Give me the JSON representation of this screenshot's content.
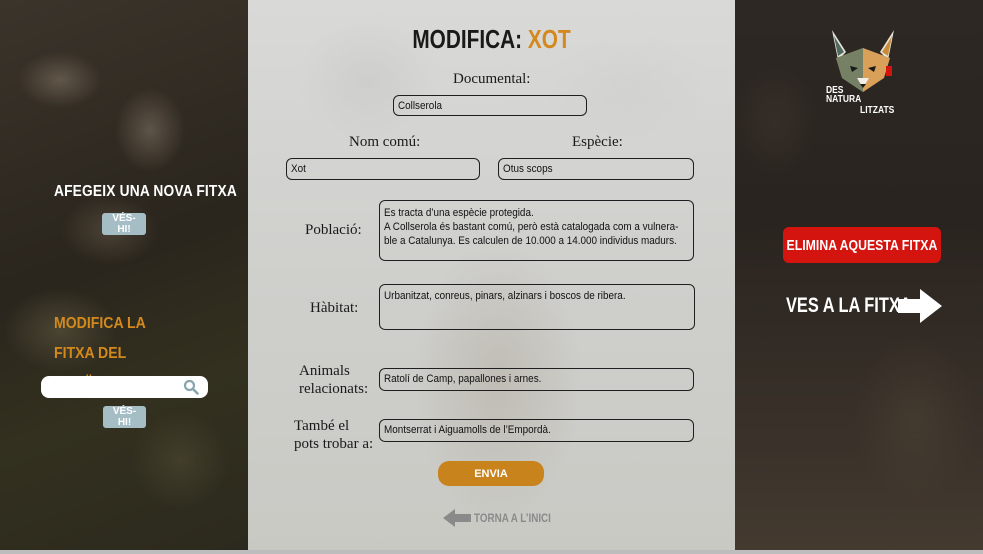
{
  "left": {
    "add_title": "AFEGEIX UNA NOVA FITXA",
    "add_button": "VÉS-HI!",
    "modify_title": "MODIFICA LA FITXA DEL SEGÜENT ANIMAL:",
    "search_value": "",
    "search_icon": "search-icon",
    "modify_button": "VÉS-HI!"
  },
  "form": {
    "title_prefix": "MODIFICA:",
    "title_animal": "XOT",
    "documental_label": "Documental:",
    "documental_value": "Collserola",
    "common_name_label": "Nom comú:",
    "common_name_value": "Xot",
    "species_label": "Espècie:",
    "species_value": "Otus scops",
    "population_label": "Població:",
    "population_value": "Es tracta d’una espècie protegida.\nA Collserola és bastant comú, però està catalogada com a vulnera-\nble a Catalunya. Es calculen de 10.000 a 14.000 individus madurs.",
    "habitat_label": "Hàbitat:",
    "habitat_value": "Urbanitzat, conreus, pinars, alzinars i boscos de ribera.",
    "related_label_1": "Animals",
    "related_label_2": "relacionats:",
    "related_value": "Ratolí de Camp, papallones i arnes.",
    "also_label_1": "També el",
    "also_label_2": "pots trobar a:",
    "also_value": "Montserrat i Aiguamolls de l’Empordà.",
    "submit_label": "ENVIA",
    "back_label": "TORNA A L’INICI"
  },
  "right": {
    "logo_line1": "DES",
    "logo_line2": "NATURA",
    "logo_line3": "LITZATS",
    "delete_label": "ELIMINA AQUESTA FITXA",
    "goto_label": "VES A LA FITXA"
  },
  "colors": {
    "accent_orange": "#d4891c",
    "delete_red": "#d4140f",
    "small_button": "#a5bec6"
  }
}
